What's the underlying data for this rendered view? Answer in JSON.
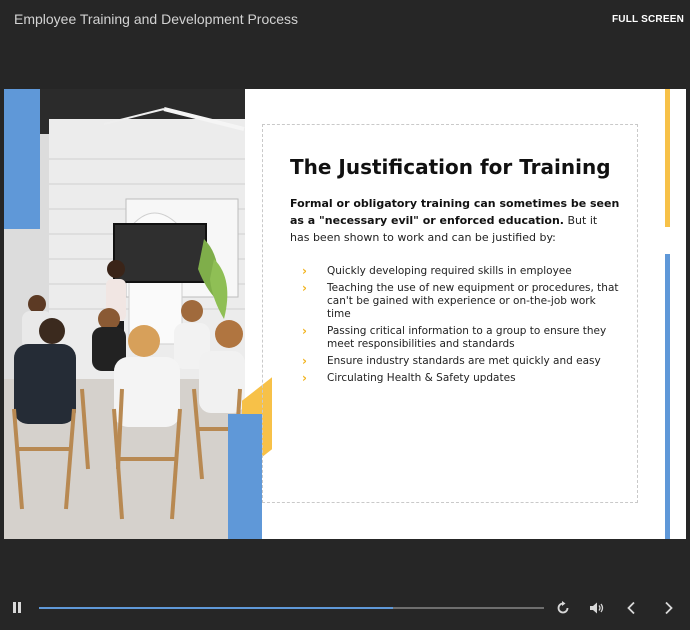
{
  "header": {
    "course_title": "Employee Training and Development Process",
    "fullscreen_label": "FULL SCREEN"
  },
  "slide": {
    "heading": "The Justification for Training",
    "intro_bold": "Formal or obligatory training can sometimes be seen as a \"necessary evil\" or enforced education.",
    "intro_rest": " But it has been shown to work and can be justified by:",
    "bullets": [
      "Quickly developing required skills in employee",
      "Teaching the use of new equipment or procedures, that can't be gained with experience or on-the-job work time",
      "Passing critical information to a group to ensure they meet responsibilities and standards",
      "Ensure industry standards are met quickly and easy",
      "Circulating Health & Safety updates"
    ],
    "colors": {
      "accent_blue": "#5f98d8",
      "accent_yellow": "#f7c148",
      "bullet": "#f2b41f"
    }
  },
  "player": {
    "progress": 0.7,
    "icons": [
      "pause-icon",
      "replay-icon",
      "volume-icon",
      "prev-icon",
      "next-icon"
    ]
  }
}
